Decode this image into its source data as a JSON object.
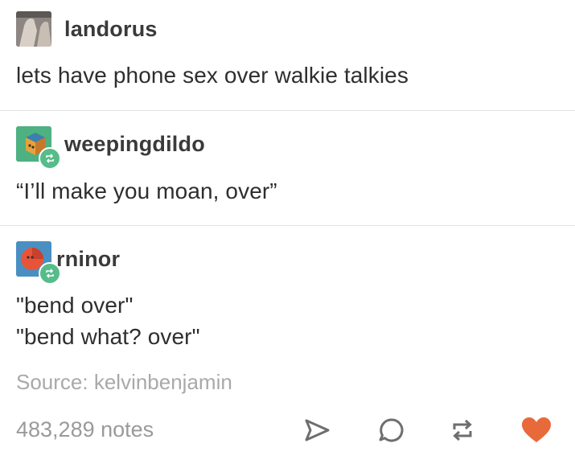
{
  "posts": [
    {
      "username": "landorus",
      "text": [
        "lets have phone sex over walkie talkies"
      ],
      "avatar_icon": "photo-avatar-icon"
    },
    {
      "username": "weepingdildo",
      "text": [
        "“I’ll make you moan, over”"
      ],
      "avatar_icon": "cube-avatar-icon"
    },
    {
      "username": "rninor",
      "text": [
        "\"bend over\"",
        "\"bend what? over\""
      ],
      "avatar_icon": "round-face-avatar-icon"
    }
  ],
  "source": "Source: kelvinbenjamin",
  "notes": "483,289 notes",
  "actions": [
    {
      "name": "share",
      "icon": "send-arrow-icon"
    },
    {
      "name": "reply",
      "icon": "speech-bubble-icon"
    },
    {
      "name": "reblog",
      "icon": "reblog-arrows-icon"
    },
    {
      "name": "like",
      "icon": "heart-icon"
    }
  ],
  "colors": {
    "reblog_badge": "#56bc8a",
    "heart": "#e86a3a",
    "icon_gray": "#6e6e6e",
    "source_gray": "#a9a9a9"
  }
}
